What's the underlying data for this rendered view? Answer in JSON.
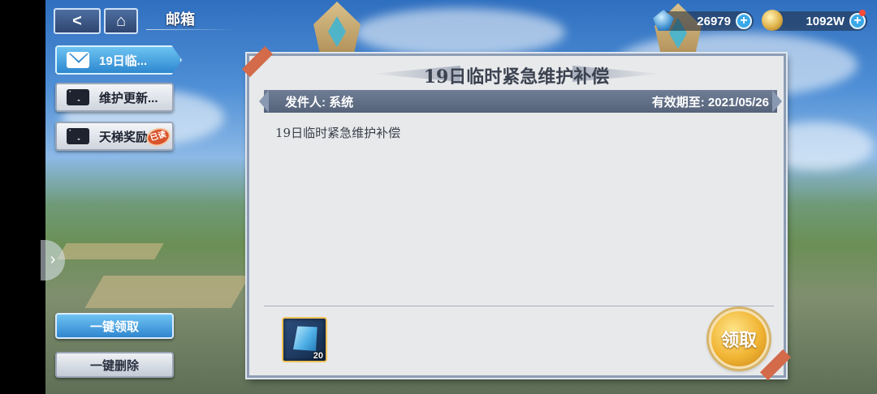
{
  "header": {
    "title": "邮箱",
    "back_label": "<",
    "home_label": "⌂"
  },
  "resources": {
    "gems": "26979",
    "gold": "1092W"
  },
  "mail_list": [
    {
      "label": "19日临...",
      "state": "selected"
    },
    {
      "label": "维护更新...",
      "state": "unread"
    },
    {
      "label": "天梯奖励",
      "state": "read",
      "badge": "已读"
    }
  ],
  "actions": {
    "claim_all": "一键领取",
    "delete_all": "一键删除"
  },
  "mail_detail": {
    "title": "19日临时紧急维护补偿",
    "sender_label": "发件人: 系统",
    "expiry_label": "有效期至: 2021/05/26",
    "body": "19日临时紧急维护补偿",
    "attachment": {
      "icon": "gem-crystal-icon",
      "count": "20"
    },
    "claim_label": "领取"
  },
  "colors": {
    "accent_blue": "#2d87cf",
    "claim_gold": "#f1b534",
    "panel_bg": "#e8e9eb"
  }
}
